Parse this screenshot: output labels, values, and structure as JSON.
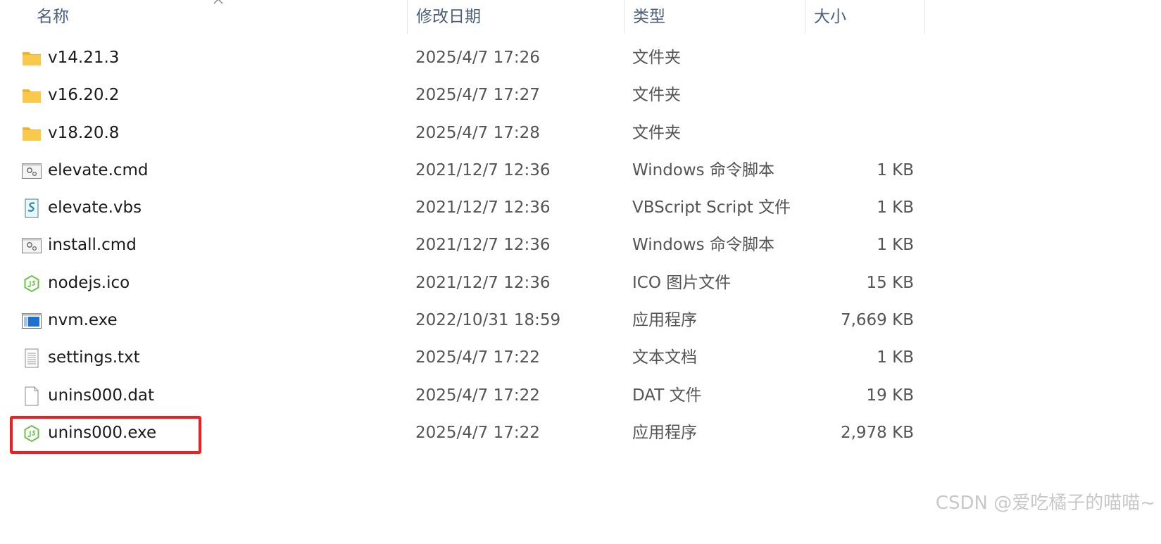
{
  "columns": {
    "name": "名称",
    "date": "修改日期",
    "type": "类型",
    "size": "大小"
  },
  "files": [
    {
      "name": "v14.21.3",
      "date": "2025/4/7 17:26",
      "type": "文件夹",
      "size": "",
      "icon": "folder-icon"
    },
    {
      "name": "v16.20.2",
      "date": "2025/4/7 17:27",
      "type": "文件夹",
      "size": "",
      "icon": "folder-icon"
    },
    {
      "name": "v18.20.8",
      "date": "2025/4/7 17:28",
      "type": "文件夹",
      "size": "",
      "icon": "folder-icon"
    },
    {
      "name": "elevate.cmd",
      "date": "2021/12/7 12:36",
      "type": "Windows 命令脚本",
      "size": "1 KB",
      "icon": "cmd-script-icon"
    },
    {
      "name": "elevate.vbs",
      "date": "2021/12/7 12:36",
      "type": "VBScript Script 文件",
      "size": "1 KB",
      "icon": "vbs-script-icon"
    },
    {
      "name": "install.cmd",
      "date": "2021/12/7 12:36",
      "type": "Windows 命令脚本",
      "size": "1 KB",
      "icon": "cmd-script-icon"
    },
    {
      "name": "nodejs.ico",
      "date": "2021/12/7 12:36",
      "type": "ICO 图片文件",
      "size": "15 KB",
      "icon": "nodejs-icon"
    },
    {
      "name": "nvm.exe",
      "date": "2022/10/31 18:59",
      "type": "应用程序",
      "size": "7,669 KB",
      "icon": "application-icon"
    },
    {
      "name": "settings.txt",
      "date": "2025/4/7 17:22",
      "type": "文本文档",
      "size": "1 KB",
      "icon": "text-document-icon"
    },
    {
      "name": "unins000.dat",
      "date": "2025/4/7 17:22",
      "type": "DAT 文件",
      "size": "19 KB",
      "icon": "blank-file-icon"
    },
    {
      "name": "unins000.exe",
      "date": "2025/4/7 17:22",
      "type": "应用程序",
      "size": "2,978 KB",
      "icon": "nodejs-icon"
    }
  ],
  "watermark": "CSDN @爱吃橘子的喵喵~",
  "colors": {
    "header_text": "#4c607a",
    "highlight_border": "#f41c1c",
    "folder": "#f8c94a",
    "nodejs_green": "#6cc24a"
  }
}
